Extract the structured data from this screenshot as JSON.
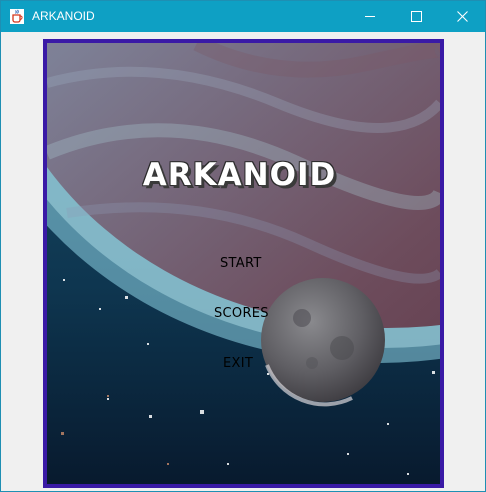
{
  "window": {
    "title": "ARKANOID",
    "app_icon": "java-cup-icon",
    "controls": {
      "minimize_icon": "minimize-icon",
      "maximize_icon": "maximize-icon",
      "close_icon": "close-icon"
    },
    "titlebar_color": "#0ea0c4"
  },
  "game": {
    "title": "ARKANOID",
    "frame_color": "#3a1aa6",
    "menu": [
      {
        "label": "START"
      },
      {
        "label": "SCORES"
      },
      {
        "label": "EXIT"
      }
    ]
  }
}
